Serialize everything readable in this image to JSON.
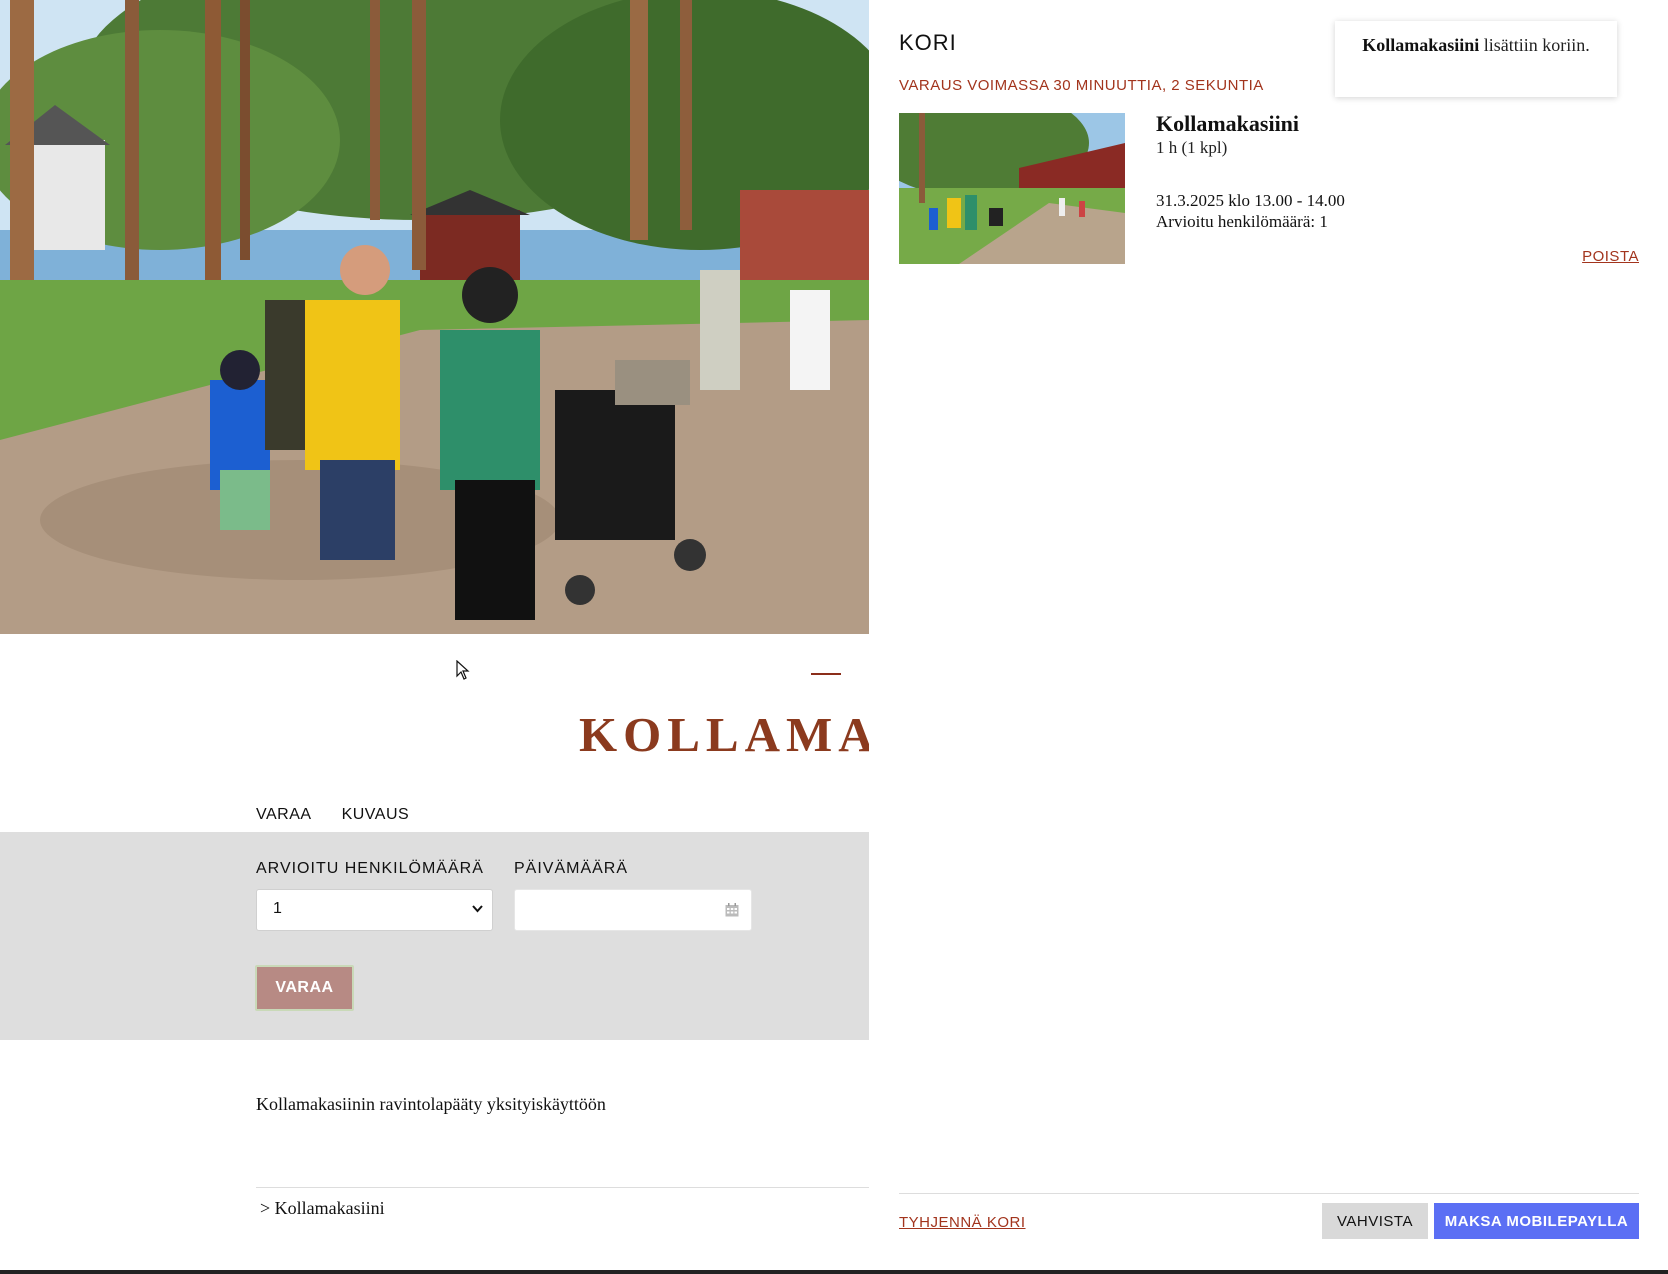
{
  "page": {
    "title": "KOLLAMAI",
    "tabs": [
      {
        "label": "VARAA"
      },
      {
        "label": "KUVAUS"
      }
    ],
    "form": {
      "persons_label": "ARVIOITU HENKILÖMÄÄRÄ",
      "persons_value": "1",
      "date_label": "PÄIVÄMÄÄRÄ",
      "date_value": "",
      "submit_label": "VARAA"
    },
    "description": "Kollamakasiinin ravintolapääty yksityiskäyttöön",
    "breadcrumb": "> Kollamakasiini"
  },
  "cart": {
    "title": "KORI",
    "timer": "VARAUS VOIMASSA 30 MINUUTTIA, 2 SEKUNTIA",
    "item": {
      "name": "Kollamakasiini",
      "quantity": "1 h (1 kpl)",
      "when": "31.3.2025 klo 13.00 - 14.00",
      "persons": "Arvioitu henkilömäärä: 1",
      "remove_label": "POISTA"
    },
    "toast": {
      "item": "Kollamakasiini",
      "message": " lisättiin koriin."
    },
    "clear_label": "TYHJENNÄ KORI",
    "confirm_label": "VAHVISTA",
    "pay_label": "MAKSA MOBILEPAYLLA"
  },
  "colors": {
    "accent": "#a2341d",
    "pay_button": "#5b6ff4",
    "form_band": "#dedede"
  },
  "icons": [
    "calendar-icon",
    "chevron-down-icon",
    "mouse-cursor-icon"
  ]
}
